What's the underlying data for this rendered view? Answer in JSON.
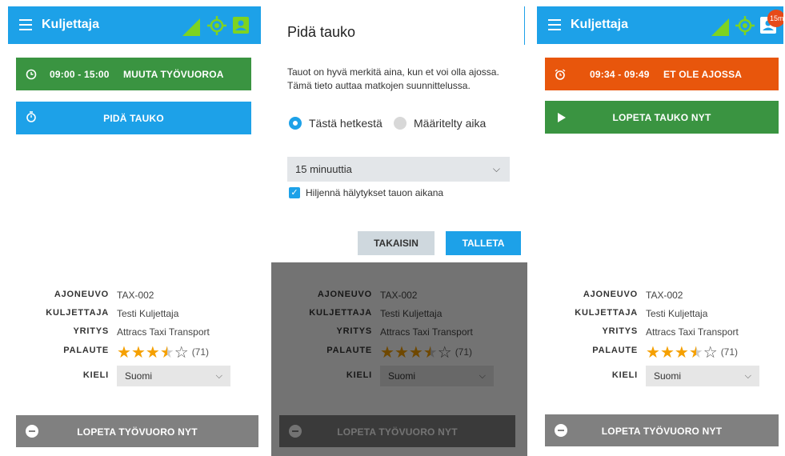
{
  "app": {
    "title": "Kuljettaja",
    "badge_count": "15m"
  },
  "panel1": {
    "shift_button": {
      "time": "09:00 - 15:00",
      "label": "MUUTA TYÖVUOROA"
    },
    "break_button": {
      "label": "PIDÄ TAUKO"
    },
    "end_shift_button": {
      "label": "LOPETA TYÖVUORO NYT"
    }
  },
  "panel3": {
    "late_button": {
      "time": "09:34 - 09:49",
      "label": "ET OLE AJOSSA"
    },
    "end_break_button": {
      "label": "LOPETA TAUKO NYT"
    },
    "end_shift_button": {
      "label": "LOPETA TYÖVUORO NYT"
    }
  },
  "info": {
    "vehicle_label": "AJONEUVO",
    "vehicle_value": "TAX-002",
    "driver_label": "KULJETTAJA",
    "driver_value": "Testi Kuljettaja",
    "company_label": "YRITYS",
    "company_value": "Attracs Taxi Transport",
    "feedback_label": "PALAUTE",
    "feedback_rating": 3.5,
    "feedback_max": 5,
    "feedback_count": "(71)",
    "language_label": "KIELI",
    "language_value": "Suomi"
  },
  "dialog": {
    "title": "Pidä tauko",
    "text": "Tauot on hyvä merkitä aina, kun et voi olla ajossa. Tämä tieto auttaa matkojen suunnittelussa.",
    "radio_now": "Tästä hetkestä",
    "radio_defined": "Määritelty aika",
    "duration_value": "15 minuuttia",
    "mute_checkbox": "Hiljennä hälytykset tauon aikana",
    "back_button": "TAKAISIN",
    "save_button": "TALLETA"
  },
  "colors": {
    "blue": "#1da1e8",
    "green": "#3a9441",
    "orange": "#e8560c",
    "grey": "#808080",
    "signal": "#7ed321",
    "star": "#f5a000"
  },
  "icons": [
    "menu-icon",
    "signal-icon",
    "gps-icon",
    "contact-icon",
    "clock-icon",
    "timer-icon",
    "alarm-icon",
    "play-icon",
    "minus-circle-icon",
    "chevron-down-icon"
  ]
}
